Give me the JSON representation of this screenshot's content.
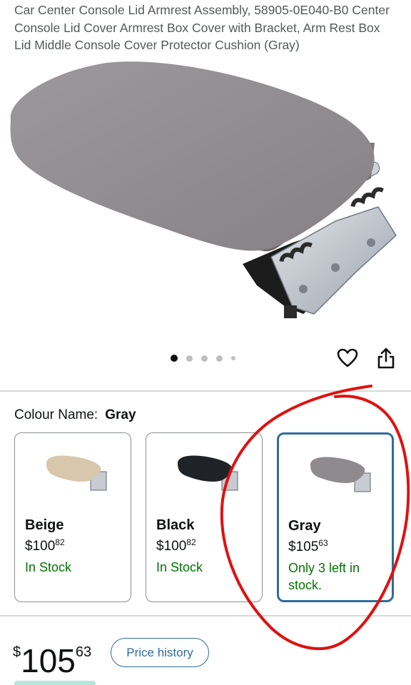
{
  "product": {
    "title": "Car Center Console Lid Armrest Assembly, 58905-0E040-B0 Center Console Lid Cover Armrest Box Cover with Bracket, Arm Rest Box Lid Middle Console Cover Protector Cushion (Gray)"
  },
  "gallery": {
    "dot_count": 5,
    "active_index": 0,
    "actions": {
      "wishlist_icon": "heart-icon",
      "share_icon": "share-icon"
    }
  },
  "colour": {
    "label": "Colour Name:",
    "selected": "Gray",
    "options": [
      {
        "name": "Beige",
        "price_symbol": "$",
        "price_whole": "100",
        "price_fraction": "82",
        "stock": "In Stock",
        "swatch_color": "#d8c6ad"
      },
      {
        "name": "Black",
        "price_symbol": "$",
        "price_whole": "100",
        "price_fraction": "82",
        "stock": "In Stock",
        "swatch_color": "#1f2226"
      },
      {
        "name": "Gray",
        "price_symbol": "$",
        "price_whole": "105",
        "price_fraction": "63",
        "stock": "Only 3 left in stock.",
        "swatch_color": "#8f8a8e"
      }
    ]
  },
  "price": {
    "symbol": "$",
    "whole": "105",
    "fraction": "63",
    "history_button": "Price history"
  },
  "colors": {
    "in_stock": "#007600",
    "selected_border": "#2f6c9c",
    "annotation": "#e01010",
    "product_gray": "#8e898d"
  }
}
